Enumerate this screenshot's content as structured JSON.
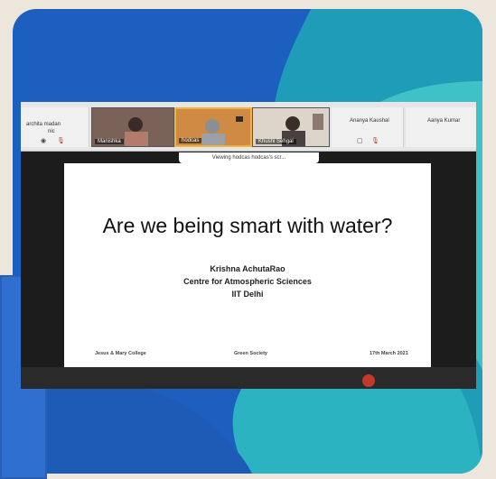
{
  "zoom": {
    "participants": [
      {
        "name": "archita madan",
        "sub": "nic",
        "kind": "name"
      },
      {
        "name": "Manishka",
        "kind": "video"
      },
      {
        "name": "hodcas",
        "kind": "video",
        "active": true
      },
      {
        "name": "Khushi Sehgal",
        "kind": "video"
      },
      {
        "name": "Ananya Kaushal",
        "kind": "name"
      },
      {
        "name": "Aanya Kumar",
        "kind": "name"
      }
    ],
    "viewing_banner": "Viewing hodcas hodcas's scr...",
    "slide": {
      "title": "Are we being smart with water?",
      "author_lines": [
        "Krishna AchutaRao",
        "Centre for Atmospheric Sciences",
        "IIT Delhi"
      ],
      "footer_left": "Jesus & Mary College",
      "footer_center": "Green Society",
      "footer_right": "17th March 2021"
    }
  },
  "colors": {
    "card": "#1c5fbf",
    "teal": "#2cb3c2",
    "active_border": "#f2b33c",
    "background": "#ece6dc"
  },
  "icons": [
    "mic-muted-icon",
    "camera-off-icon",
    "record-icon"
  ]
}
